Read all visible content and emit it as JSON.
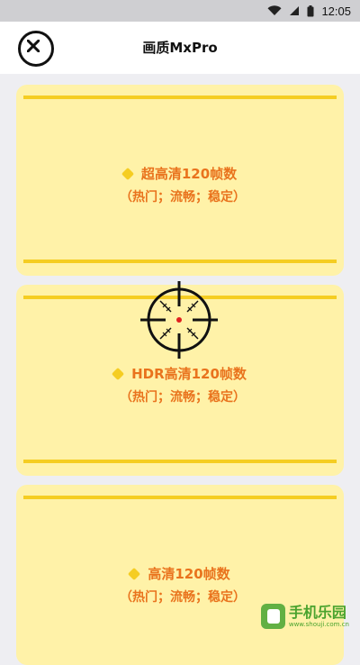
{
  "statusbar": {
    "time": "12:05"
  },
  "header": {
    "title": "画质MxPro"
  },
  "cards": [
    {
      "title": "超高清120帧数",
      "tags": "（热门；流畅；稳定）"
    },
    {
      "title": "HDR高清120帧数",
      "tags": "（热门；流畅；稳定）"
    },
    {
      "title": "高清120帧数",
      "tags": "（热门；流畅；稳定）"
    }
  ],
  "watermark": {
    "brand": "手机乐园",
    "url": "www.shouji.com.cn",
    "color": "#4aa32e"
  },
  "colors": {
    "card_bg": "#fff2a8",
    "accent_yellow": "#f5cd22",
    "text_orange": "#e9731d"
  },
  "icons": [
    "wifi-icon",
    "signal-icon",
    "battery-icon",
    "close-icon",
    "crosshair-icon"
  ]
}
